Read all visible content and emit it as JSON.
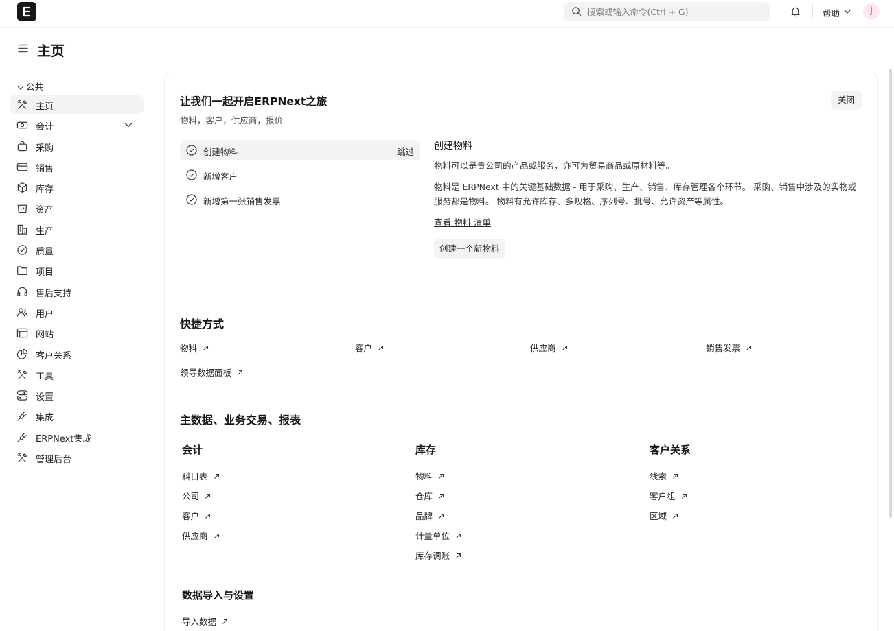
{
  "navbar": {
    "search_placeholder": "搜索或输入命令(Ctrl + G)",
    "help_label": "帮助",
    "avatar_initial": "j"
  },
  "page": {
    "title": "主页"
  },
  "sidebar": {
    "group_label": "公共",
    "items": [
      {
        "label": "主页",
        "icon": "tools-icon"
      },
      {
        "label": "会计",
        "icon": "money-icon"
      },
      {
        "label": "采购",
        "icon": "bag-icon"
      },
      {
        "label": "销售",
        "icon": "card-icon"
      },
      {
        "label": "库存",
        "icon": "box-icon"
      },
      {
        "label": "资产",
        "icon": "asset-icon"
      },
      {
        "label": "生产",
        "icon": "factory-icon"
      },
      {
        "label": "质量",
        "icon": "shield-icon"
      },
      {
        "label": "项目",
        "icon": "folder-icon"
      },
      {
        "label": "售后支持",
        "icon": "headset-icon"
      },
      {
        "label": "用户",
        "icon": "users-icon"
      },
      {
        "label": "网站",
        "icon": "browser-icon"
      },
      {
        "label": "客户关系",
        "icon": "pie-icon"
      },
      {
        "label": "工具",
        "icon": "tools-icon"
      },
      {
        "label": "设置",
        "icon": "toggle-icon"
      },
      {
        "label": "集成",
        "icon": "plug-icon"
      },
      {
        "label": "ERPNext集成",
        "icon": "plug-icon"
      },
      {
        "label": "管理后台",
        "icon": "tools-icon"
      }
    ]
  },
  "onboarding": {
    "title": "让我们一起开启ERPNext之旅",
    "subtitle": "物料，客户，供应商，报价",
    "close_label": "关闭",
    "steps": [
      {
        "label": "创建物料",
        "skip": "跳过"
      },
      {
        "label": "新增客户"
      },
      {
        "label": "新增第一张销售发票"
      }
    ],
    "detail": {
      "title": "创建物料",
      "p1": "物料可以是贵公司的产品或服务，亦可为贸易商品或原材料等。",
      "p2": "物料是 ERPNext 中的关键基础数据 - 用于采购、生产、销售、库存管理各个环节。 采购、销售中涉及的实物或服务都是物料。 物料有允许库存、多规格、序列号、批号、允许资产等属性。",
      "link": "查看 物料 清单",
      "button": "创建一个新物料"
    }
  },
  "shortcuts": {
    "title": "快捷方式",
    "items": [
      "物料",
      "客户",
      "供应商",
      "销售发票",
      "领导数据面板"
    ]
  },
  "masters": {
    "title": "主数据、业务交易、报表",
    "columns": [
      {
        "title": "会计",
        "links": [
          "科目表",
          "公司",
          "客户",
          "供应商"
        ]
      },
      {
        "title": "库存",
        "links": [
          "物料",
          "仓库",
          "品牌",
          "计量单位",
          "库存调账"
        ]
      },
      {
        "title": "客户关系",
        "links": [
          "线索",
          "客户组",
          "区域"
        ]
      }
    ],
    "import": {
      "title": "数据导入与设置",
      "links": [
        "导入数据"
      ]
    }
  }
}
